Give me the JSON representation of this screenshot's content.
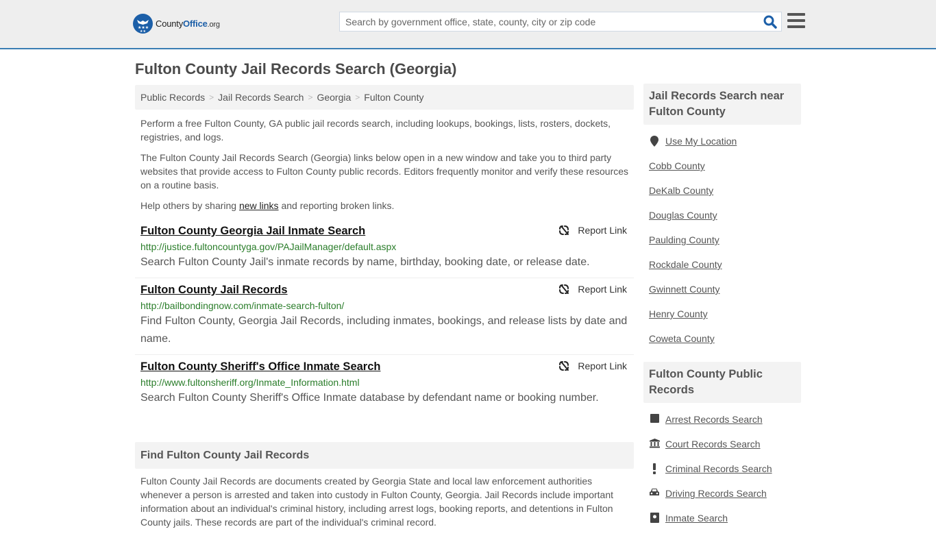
{
  "header": {
    "logo": {
      "county": "County",
      "office": "Office",
      "org": ".org"
    },
    "search_placeholder": "Search by government office, state, county, city or zip code",
    "search_value": ""
  },
  "page_title": "Fulton County Jail Records Search (Georgia)",
  "breadcrumb": [
    "Public Records",
    "Jail Records Search",
    "Georgia",
    "Fulton County"
  ],
  "breadcrumb_separator": ">",
  "intro": {
    "p1": "Perform a free Fulton County, GA public jail records search, including lookups, bookings, lists, rosters, dockets, registries, and logs.",
    "p2": "The Fulton County Jail Records Search (Georgia) links below open in a new window and take you to third party websites that provide access to Fulton County public records. Editors frequently monitor and verify these resources on a routine basis.",
    "p3_before": "Help others by sharing ",
    "p3_link": "new links",
    "p3_after": " and reporting broken links."
  },
  "results": [
    {
      "title": "Fulton County Georgia Jail Inmate Search",
      "url": "http://justice.fultoncountyga.gov/PAJailManager/default.aspx",
      "desc": "Search Fulton County Jail's inmate records by name, birthday, booking date, or release date.",
      "report": "Report Link"
    },
    {
      "title": "Fulton County Jail Records",
      "url": "http://bailbondingnow.com/inmate-search-fulton/",
      "desc": "Find Fulton County, Georgia Jail Records, including inmates, bookings, and release lists by date and name.",
      "report": "Report Link"
    },
    {
      "title": "Fulton County Sheriff's Office Inmate Search",
      "url": "http://www.fultonsheriff.org/Inmate_Information.html",
      "desc": "Search Fulton County Sheriff's Office Inmate database by defendant name or booking number.",
      "report": "Report Link"
    }
  ],
  "find_section": {
    "heading": "Find Fulton County Jail Records",
    "body": "Fulton County Jail Records are documents created by Georgia State and local law enforcement authorities whenever a person is arrested and taken into custody in Fulton County, Georgia. Jail Records include important information about an individual's criminal history, including arrest logs, booking reports, and detentions in Fulton County jails. These records are part of the individual's criminal record."
  },
  "sidebar": {
    "near_heading": "Jail Records Search near Fulton County",
    "use_location": "Use My Location",
    "counties": [
      "Cobb County",
      "DeKalb County",
      "Douglas County",
      "Paulding County",
      "Rockdale County",
      "Gwinnett County",
      "Henry County",
      "Coweta County"
    ],
    "public_heading": "Fulton County Public Records",
    "public_links": [
      {
        "label": "Arrest Records Search",
        "icon": "square-icon"
      },
      {
        "label": "Court Records Search",
        "icon": "courthouse-icon"
      },
      {
        "label": "Criminal Records Search",
        "icon": "exclamation-icon"
      },
      {
        "label": "Driving Records Search",
        "icon": "car-icon"
      },
      {
        "label": "Inmate Search",
        "icon": "inmate-icon"
      }
    ]
  },
  "colors": {
    "accent": "#3a7db3",
    "brand_blue": "#1c5fa8",
    "url_green": "#2a7d2a",
    "header_bg": "#eeeeee",
    "panel_bg": "#f3f3f3"
  }
}
